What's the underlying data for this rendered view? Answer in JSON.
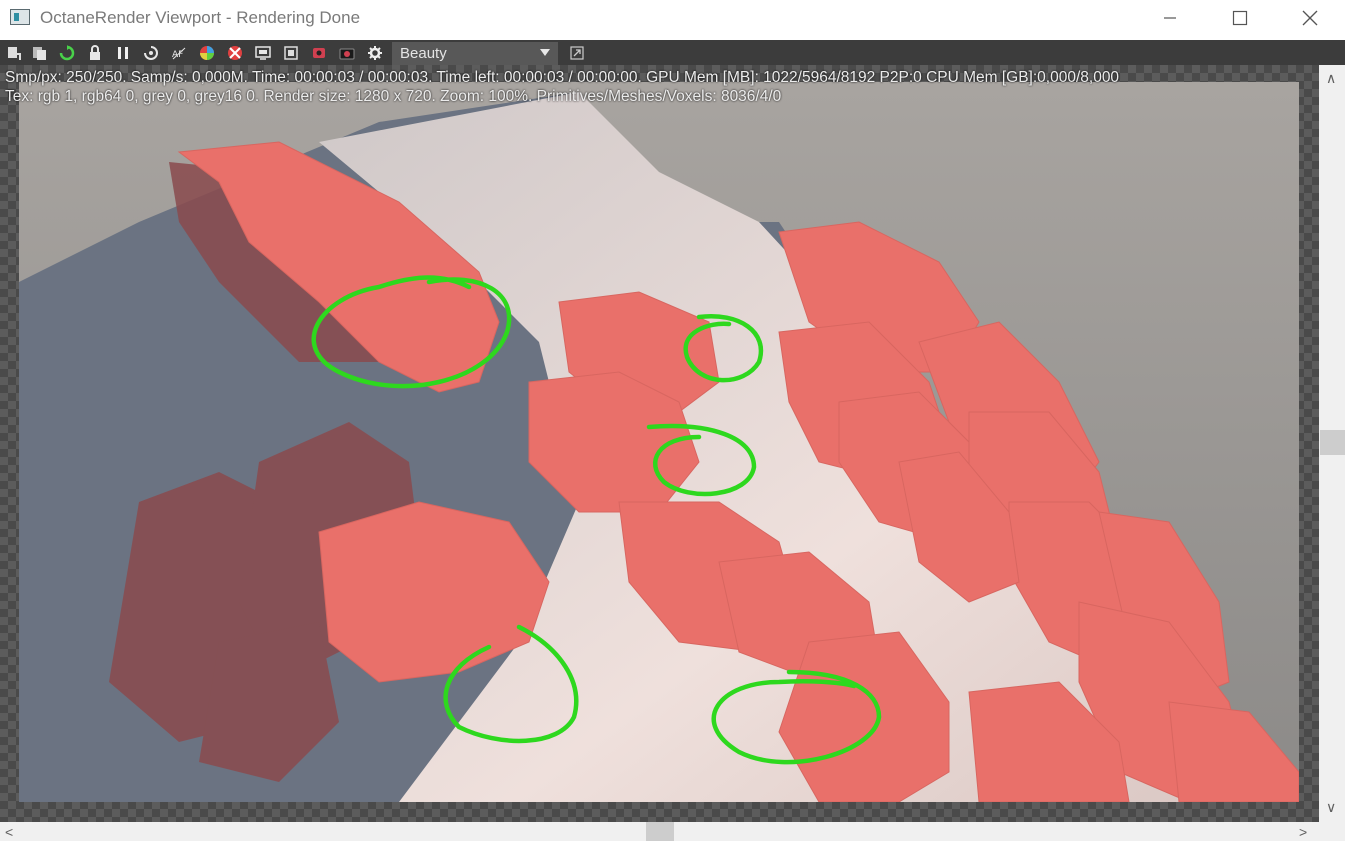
{
  "window": {
    "title": "OctaneRender Viewport - Rendering Done",
    "controls": {
      "minimize": "—",
      "maximize": "☐",
      "close": "✕"
    }
  },
  "toolbar": {
    "icons": [
      "save-render-icon",
      "copy-clipboard-icon",
      "restart-render-icon",
      "lock-viewport-icon",
      "pause-render-icon",
      "reset-camera-icon",
      "focus-picker-icon",
      "color-picker-icon",
      "clay-mode-icon",
      "render-region-icon",
      "film-region-icon",
      "material-picker-icon",
      "camera-icon",
      "settings-gear-icon"
    ],
    "render_pass": "Beauty",
    "extra_icon": "show-window-icon"
  },
  "stats": {
    "line1": "Smp/px: 250/250.  Samp/s: 0,000M.  Time: 00:00:03 / 00:00:03.  Time left: 00:00:03 / 00:00:00.  GPU Mem [MB]: 1022/5964/8192 P2P:0  CPU Mem [GB]:0,000/8,000",
    "line2": "Tex: rgb 1, rgb64 0, grey 0, grey16 0.  Render size: 1280 x 720.  Zoom: 100%.  Primitives/Meshes/Voxels: 8036/4/0"
  },
  "colors": {
    "toolbar_bg": "#3c3c3c",
    "dropdown_bg": "#585858",
    "leaf": "#e9706a",
    "leaf_shadow": "#8a4a4e",
    "surface": "#d8cfcf",
    "annotation": "#2ed81e"
  },
  "scrollbars": {
    "up": "∧",
    "down": "∨",
    "left": "<",
    "right": ">"
  }
}
